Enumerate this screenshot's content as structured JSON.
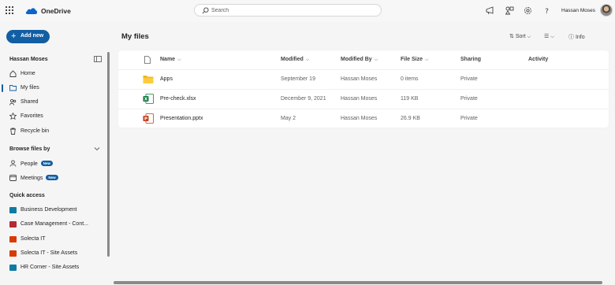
{
  "app": {
    "name": "OneDrive"
  },
  "search": {
    "placeholder": "Search"
  },
  "user": {
    "name": "Hassan Moses"
  },
  "sidebar": {
    "add_new_label": "Add new",
    "user_name": "Hassan Moses",
    "nav": [
      {
        "label": "Home",
        "icon": "home-icon"
      },
      {
        "label": "My files",
        "icon": "folder-icon"
      },
      {
        "label": "Shared",
        "icon": "people-icon"
      },
      {
        "label": "Favorites",
        "icon": "star-icon"
      },
      {
        "label": "Recycle bin",
        "icon": "trash-icon"
      }
    ],
    "browse_heading": "Browse files by",
    "browse": [
      {
        "label": "People",
        "badge": "New"
      },
      {
        "label": "Meetings",
        "badge": "New"
      }
    ],
    "quick_access_heading": "Quick access",
    "quick_access": [
      {
        "label": "Business Development",
        "color": "#0f7ba3"
      },
      {
        "label": "Case Management - Cont...",
        "color": "#b42a35"
      },
      {
        "label": "Solecta IT",
        "color": "#d83b01"
      },
      {
        "label": "Solecta IT - Site Assets",
        "color": "#d83b01"
      },
      {
        "label": "HR Corner - Site Assets",
        "color": "#0f7ba3"
      }
    ]
  },
  "main": {
    "title": "My files",
    "sort_label": "Sort",
    "info_label": "Info",
    "columns": {
      "name": "Name",
      "modified": "Modified",
      "modified_by": "Modified By",
      "file_size": "File Size",
      "sharing": "Sharing",
      "activity": "Activity"
    },
    "files": [
      {
        "name": "Apps",
        "type": "folder",
        "modified": "September 19",
        "modified_by": "Hassan Moses",
        "size": "0 items",
        "sharing": "Private"
      },
      {
        "name": "Pre-check.xlsx",
        "type": "excel",
        "modified": "December 9, 2021",
        "modified_by": "Hassan Moses",
        "size": "119 KB",
        "sharing": "Private"
      },
      {
        "name": "Presentation.pptx",
        "type": "powerpoint",
        "modified": "May 2",
        "modified_by": "Hassan Moses",
        "size": "26.9 KB",
        "sharing": "Private"
      }
    ]
  },
  "colors": {
    "accent": "#115ea3",
    "excel": "#107c41",
    "powerpoint": "#c43e1c",
    "folder": "#f2b720"
  }
}
